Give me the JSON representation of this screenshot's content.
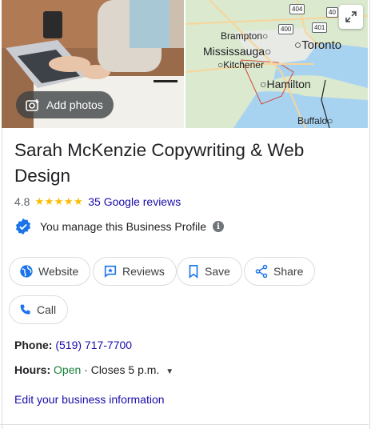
{
  "header": {
    "add_photos_label": "Add photos",
    "map": {
      "highways": [
        "404",
        "40",
        "400",
        "401"
      ],
      "cities": {
        "brampton": "Brampton",
        "mississauga": "Mississauga",
        "toronto": "Toronto",
        "kitchener": "Kitchener",
        "hamilton": "Hamilton",
        "buffalo": "Buffalo"
      }
    }
  },
  "business": {
    "name": "Sarah McKenzie Copywriting & Web Design",
    "rating": "4.8",
    "stars": "★★★★★",
    "reviews_label": "35 Google reviews",
    "managed_text": "You manage this Business Profile"
  },
  "actions": {
    "website": "Website",
    "reviews": "Reviews",
    "save": "Save",
    "share": "Share",
    "call": "Call"
  },
  "details": {
    "phone_label": "Phone:",
    "phone_value": "(519) 717-7700",
    "hours_label": "Hours:",
    "hours_status": "Open",
    "hours_close": " · Closes 5 p.m.",
    "edit_link": "Edit your business information"
  },
  "colors": {
    "link": "#1a0dab",
    "open": "#188038",
    "star": "#fbbc04",
    "verified": "#1a73e8"
  }
}
